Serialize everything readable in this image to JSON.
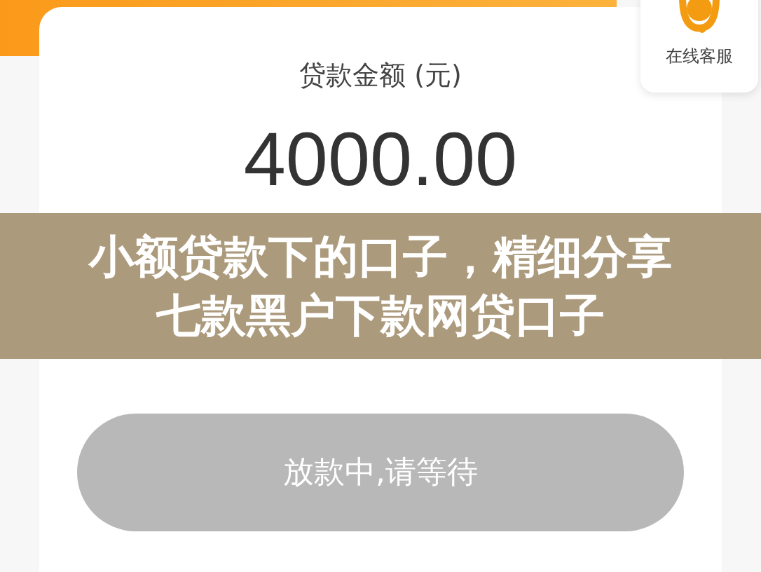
{
  "service": {
    "label": "在线客服"
  },
  "card": {
    "label": "贷款金额 (元)",
    "amount": "4000.00"
  },
  "button": {
    "label": "放款中,请等待",
    "disabled": true
  },
  "caption": {
    "lines": [
      "小额贷款下的口子，精细分享",
      "七款黑户下款网贷口子"
    ]
  }
}
